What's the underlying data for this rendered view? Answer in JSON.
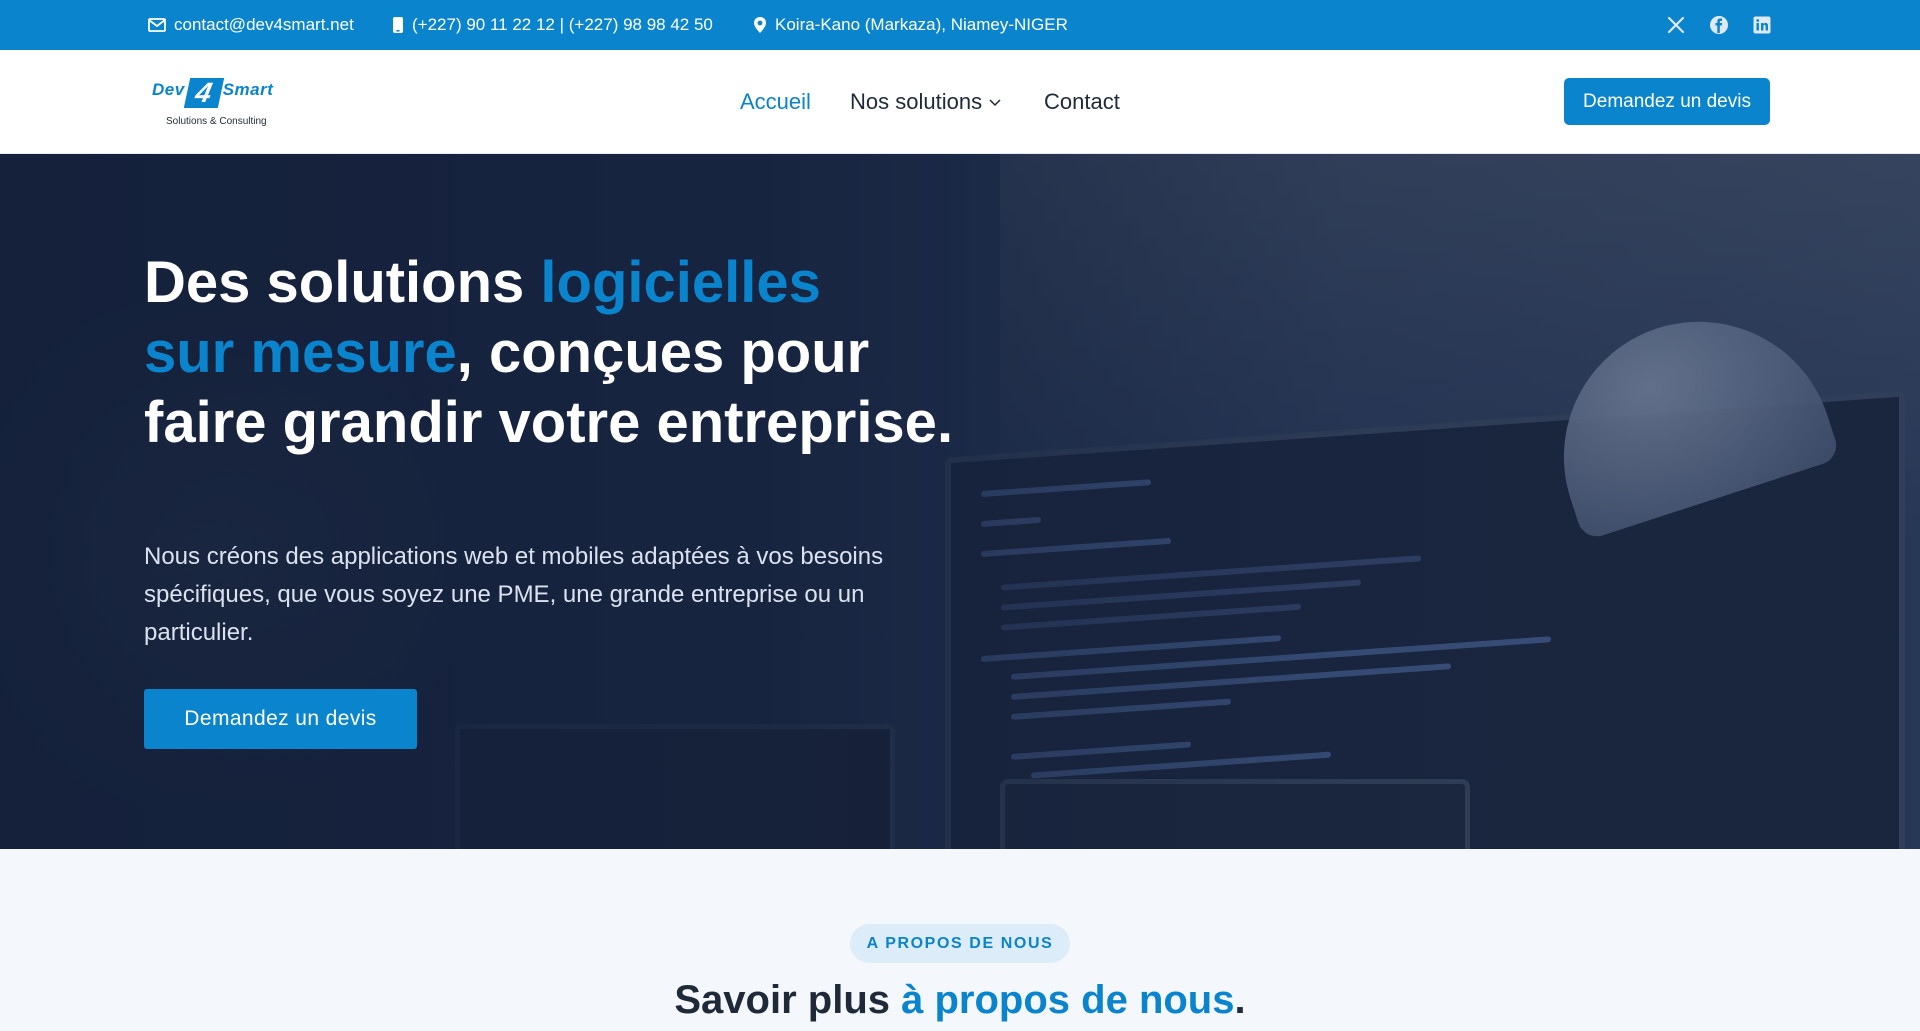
{
  "topbar": {
    "email": "contact@dev4smart.net",
    "phone": "(+227) 90 11 22 12 | (+227) 98 98 42 50",
    "address": "Koira-Kano (Markaza), Niamey-NIGER",
    "social": [
      "x-icon",
      "facebook-icon",
      "linkedin-icon"
    ],
    "bg_color": "#0a84cc"
  },
  "header": {
    "logo": {
      "brand_left": "Dev",
      "brand_num": "4",
      "brand_right": "Smart",
      "tagline": "Solutions & Consulting"
    },
    "nav": [
      {
        "label": "Accueil",
        "active": true
      },
      {
        "label": "Nos solutions",
        "has_dropdown": true
      },
      {
        "label": "Contact"
      }
    ],
    "cta_label": "Demandez un devis"
  },
  "hero": {
    "title_part1": "Des solutions ",
    "title_hl1": "logicielles",
    "title_hl2": "sur mesure",
    "title_part2": ", conçues pour faire grandir votre entreprise.",
    "subtitle": "Nous créons des applications web et mobiles adaptées à vos besoins spécifiques, que vous soyez une PME, une grande entreprise ou un particulier.",
    "cta_label": "Demandez un devis"
  },
  "about": {
    "badge": "A PROPOS DE NOUS",
    "title_part1": "Savoir plus ",
    "title_hl": "à propos de nous",
    "title_part2": "."
  },
  "colors": {
    "accent": "#0a84cc",
    "dark_text": "#1e2a38",
    "hero_bg": "#1f3050"
  }
}
